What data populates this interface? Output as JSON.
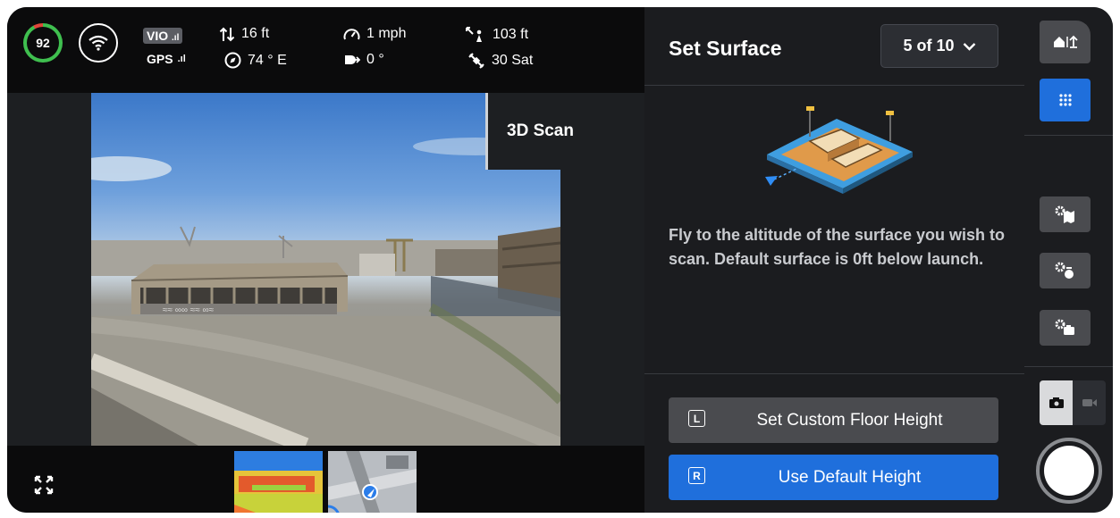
{
  "telemetry": {
    "battery": "92",
    "vio_label": "VIO",
    "gps_label": "GPS",
    "altitude": "16 ft",
    "heading": "74 ° E",
    "speed": "1 mph",
    "gimbal": "0 °",
    "distance": "103 ft",
    "satellites": "30 Sat"
  },
  "mode_panel": {
    "label": "3D Scan"
  },
  "panel": {
    "title": "Set Surface",
    "step": "5 of 10",
    "description": "Fly to the altitude of the surface you wish to scan. Default surface is 0ft below launch.",
    "buttons": [
      {
        "key": "L",
        "label": "Set Custom Floor Height"
      },
      {
        "key": "R",
        "label": "Use Default Height"
      }
    ]
  },
  "colors": {
    "accent_blue": "#1f6fdc",
    "battery_green": "#3fbf4f"
  },
  "icons": {
    "wifi": "wifi-icon",
    "altitude": "altitude-arrows-icon",
    "compass": "compass-icon",
    "speed": "speedometer-icon",
    "gimbal": "gimbal-icon",
    "distance": "distance-icon",
    "satellite": "satellite-icon",
    "expand": "expand-icon",
    "home": "home-altitude-icon",
    "grid": "grid-icon",
    "photo": "camera-icon",
    "video": "video-icon"
  }
}
